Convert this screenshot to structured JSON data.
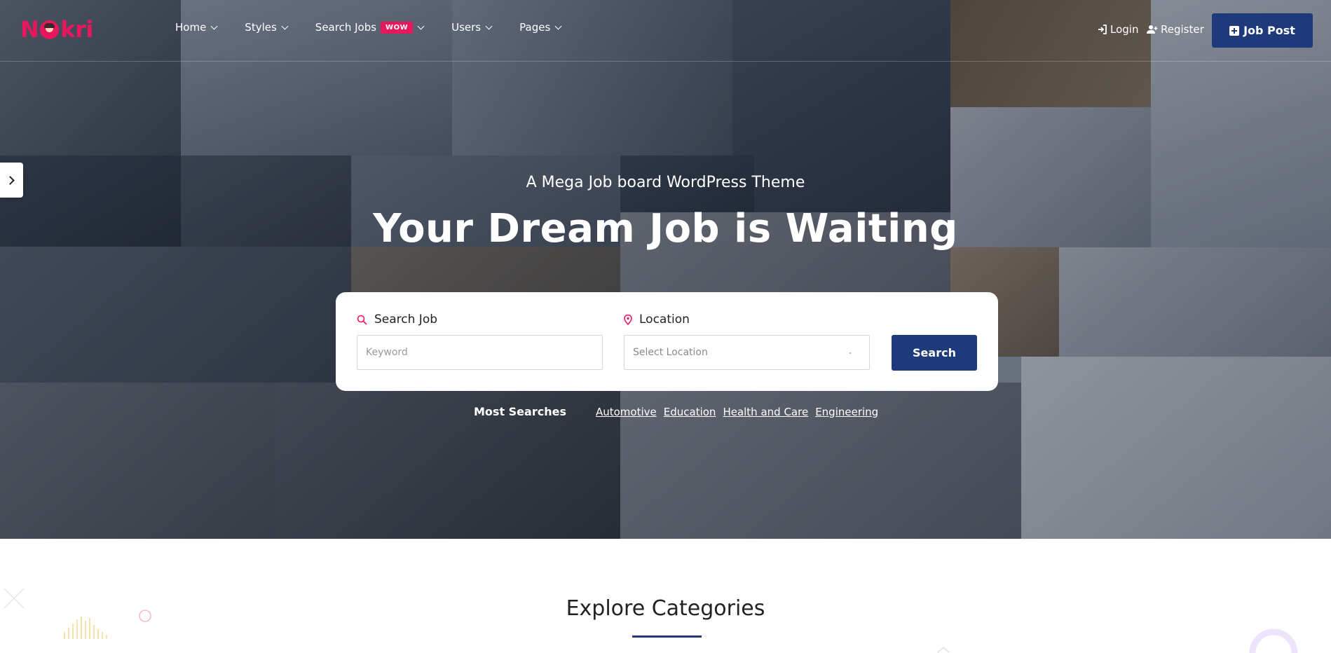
{
  "brand": {
    "logo_text_left": "N",
    "logo_text_right": "kri",
    "accent": "#e8175d",
    "primary": "#1f3a7a"
  },
  "nav": {
    "items": [
      {
        "label": "Home"
      },
      {
        "label": "Styles"
      },
      {
        "label": "Search Jobs",
        "badge": "WOW"
      },
      {
        "label": "Users"
      },
      {
        "label": "Pages"
      }
    ]
  },
  "auth": {
    "login": "Login",
    "register": "Register",
    "job_post": "Job Post"
  },
  "hero": {
    "subtitle": "A Mega Job board WordPress Theme",
    "title": "Your Dream Job is Waiting"
  },
  "search": {
    "job_label": "Search Job",
    "keyword_placeholder": "Keyword",
    "location_label": "Location",
    "location_placeholder": "Select Location",
    "button": "Search"
  },
  "most_searches": {
    "label": "Most Searches",
    "links": [
      "Automotive",
      "Education",
      "Health and Care",
      "Engineering"
    ]
  },
  "section": {
    "title": "Explore Categories"
  }
}
